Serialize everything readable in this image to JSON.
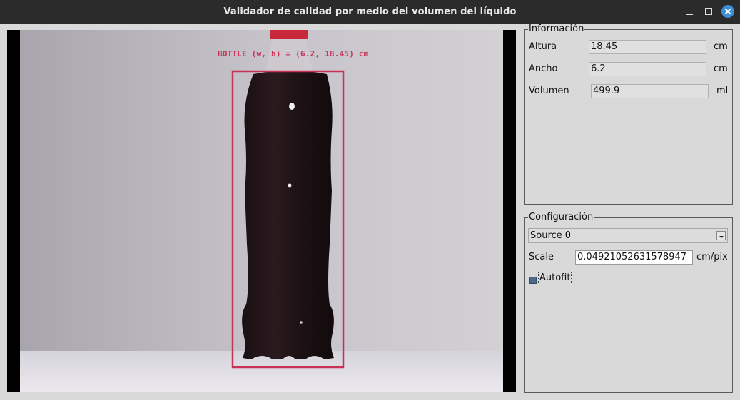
{
  "window": {
    "title": "Validador de calidad por medio del volumen del líquido"
  },
  "video": {
    "detection_label": "BOTTLE (w, h) = (6.2, 18.45) cm",
    "box_color": "#c63357"
  },
  "info": {
    "title": "Información",
    "rows": [
      {
        "label": "Altura",
        "value": "18.45",
        "unit": "cm"
      },
      {
        "label": "Ancho",
        "value": "6.2",
        "unit": "cm"
      },
      {
        "label": "Volumen",
        "value": "499.9",
        "unit": "ml"
      }
    ]
  },
  "config": {
    "title": "Configuración",
    "source_selected": "Source 0",
    "scale_label": "Scale",
    "scale_value": "0.04921052631578947",
    "scale_unit": "cm/pix",
    "autofit_label": "Autofit",
    "autofit_checked": true
  },
  "icons": {
    "minimize": "minimize-icon",
    "maximize": "maximize-icon",
    "close": "close-icon",
    "dropdown": "chevron-down-icon"
  }
}
